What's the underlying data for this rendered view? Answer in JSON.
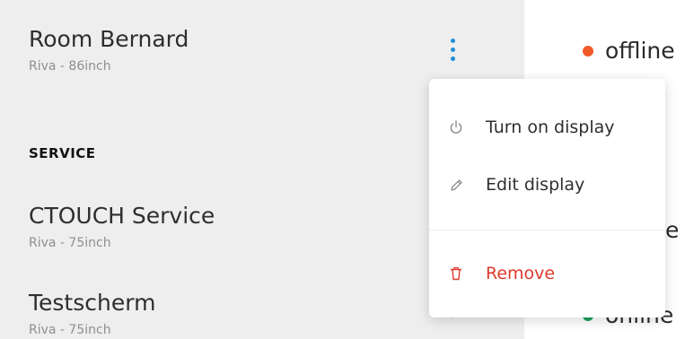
{
  "devices": [
    {
      "name": "Room Bernard",
      "model": "Riva - 86inch"
    },
    {
      "name": "CTOUCH Service",
      "model": "Riva - 75inch"
    },
    {
      "name": "Testscherm",
      "model": "Riva - 75inch"
    }
  ],
  "section": {
    "title": "SERVICE"
  },
  "statuses": [
    {
      "label": "offline",
      "color": "#f05a28"
    },
    {
      "label": "e"
    },
    {
      "label": "online",
      "color": "#1aa35f"
    }
  ],
  "menu": {
    "items": [
      {
        "label": "Turn on display",
        "icon": "power-icon"
      },
      {
        "label": "Edit display",
        "icon": "pencil-icon"
      },
      {
        "label": "Remove",
        "icon": "trash-icon",
        "color": "#e0392f"
      }
    ]
  },
  "colors": {
    "panel_bg": "#eeeeee",
    "kebab_accent": "#1f8fd6",
    "danger": "#e0392f"
  }
}
